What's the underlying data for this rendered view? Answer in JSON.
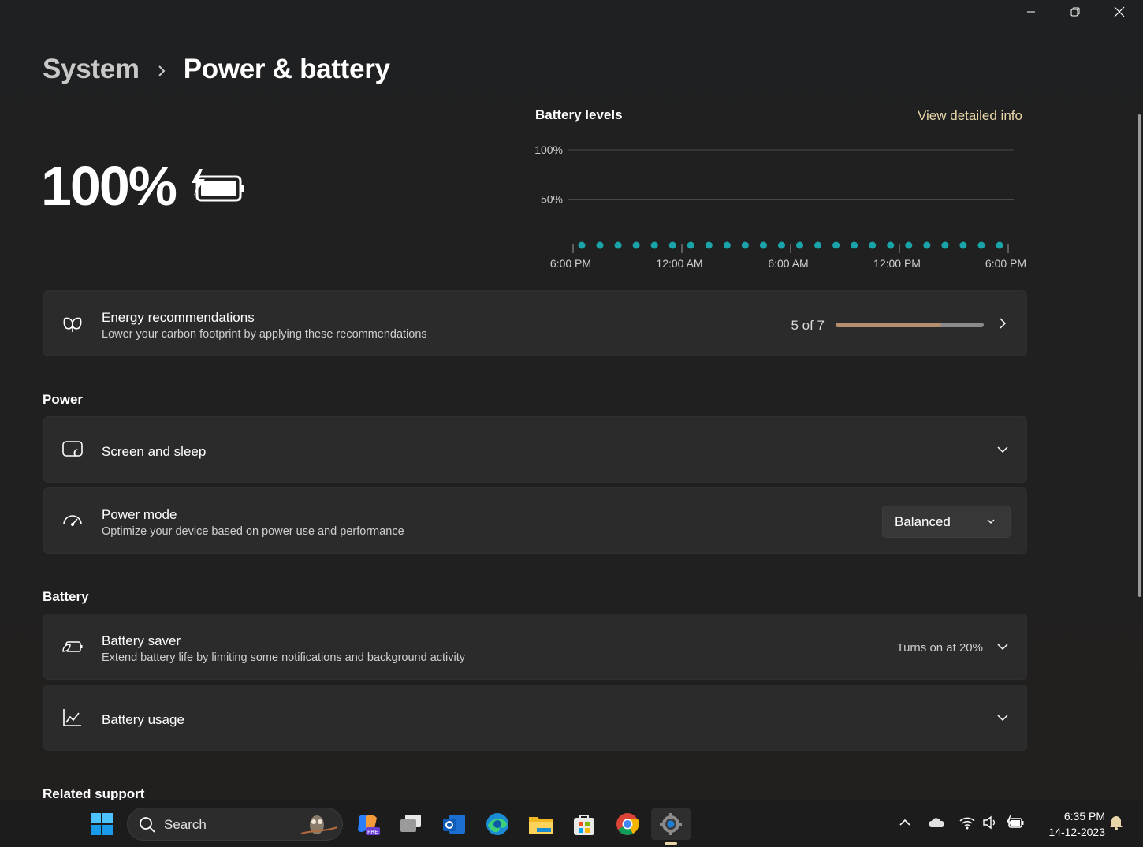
{
  "window": {
    "controls": [
      "minimize",
      "restore",
      "close"
    ]
  },
  "breadcrumb": {
    "parent": "System",
    "separator": "›",
    "current": "Power & battery"
  },
  "battery": {
    "percent_label": "100%",
    "charging": true
  },
  "chart": {
    "title": "Battery levels",
    "link": "View detailed info"
  },
  "chart_data": {
    "type": "scatter",
    "title": "Battery levels",
    "y_tick_labels": [
      "100%",
      "50%"
    ],
    "x_tick_labels": [
      "6:00 PM",
      "12:00 AM",
      "6:00 AM",
      "12:00 PM",
      "6:00 PM"
    ],
    "ylim": [
      0,
      100
    ],
    "grid": true,
    "series": [
      {
        "values": [
          0,
          0,
          0,
          0,
          0,
          0,
          0,
          0,
          0,
          0,
          0,
          0,
          0,
          0,
          0,
          0,
          0,
          0,
          0,
          0,
          0,
          0,
          0,
          0
        ]
      }
    ],
    "colors": {
      "dot": "#1aa3a8",
      "grid": "#4a4a4a"
    }
  },
  "energy": {
    "title": "Energy recommendations",
    "subtitle": "Lower your carbon footprint by applying these recommendations",
    "progress_label": "5 of 7",
    "progress_fraction": 0.714
  },
  "power_section": {
    "heading": "Power",
    "screen_sleep": {
      "title": "Screen and sleep"
    },
    "power_mode": {
      "title": "Power mode",
      "subtitle": "Optimize your device based on power use and performance",
      "selected": "Balanced"
    }
  },
  "battery_section": {
    "heading": "Battery",
    "saver": {
      "title": "Battery saver",
      "subtitle": "Extend battery life by limiting some notifications and background activity",
      "status": "Turns on at 20%"
    },
    "usage": {
      "title": "Battery usage"
    }
  },
  "related": {
    "heading": "Related support"
  },
  "taskbar": {
    "search_placeholder": "Search",
    "apps": [
      "start-icon",
      "copilot-icon",
      "task-view-icon",
      "outlook-icon",
      "edge-icon",
      "file-explorer-icon",
      "store-icon",
      "chrome-icon",
      "settings-icon"
    ],
    "time": "6:35 PM",
    "date": "14-12-2023"
  },
  "colors": {
    "accent_link": "#e8d6a8",
    "progress_fill": "#b48e6d",
    "chart_dot": "#1aa3a8"
  }
}
